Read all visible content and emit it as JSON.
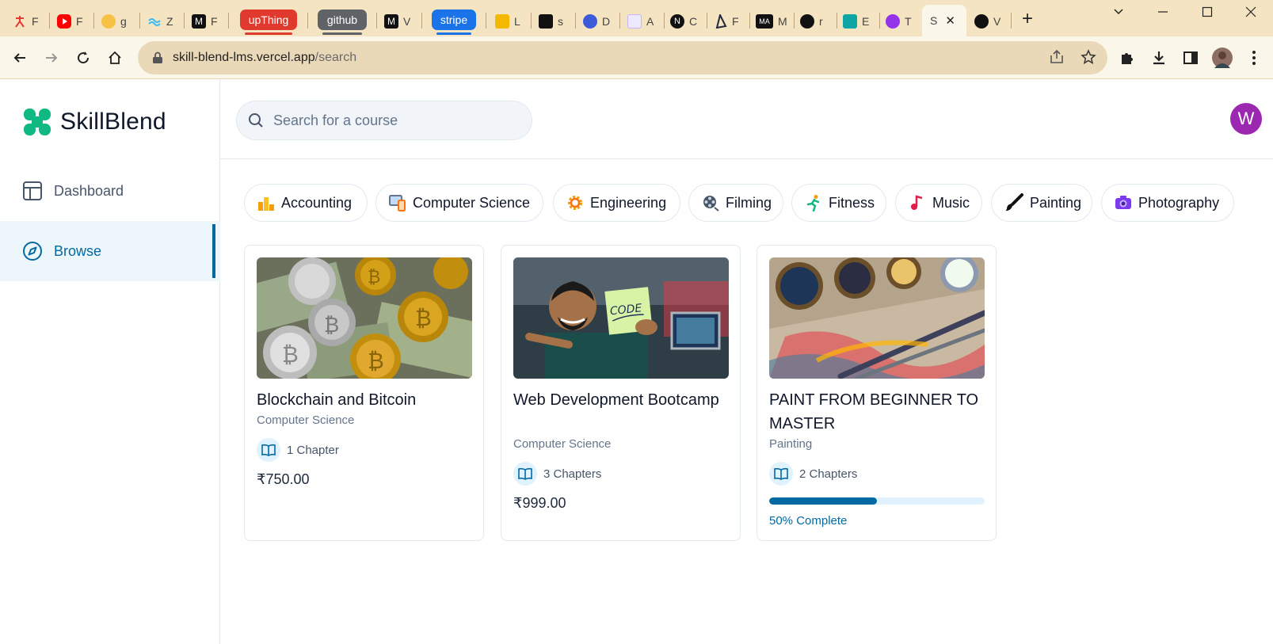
{
  "browser": {
    "tabs": [
      {
        "letter": "F",
        "icon": "figure-icon",
        "color": "#e53935"
      },
      {
        "letter": "F",
        "icon": "youtube-icon",
        "color": "#ff0000"
      },
      {
        "letter": "g",
        "icon": "emoji-icon",
        "color": "#f7c244"
      },
      {
        "letter": "Z",
        "icon": "wave-icon",
        "color": "#38bdf8"
      },
      {
        "letter": "F",
        "icon": "m-logo-icon",
        "color": "#111111"
      }
    ],
    "group_pills": [
      {
        "label": "upThing",
        "color": "#e03a2f"
      },
      {
        "label": "github",
        "color": "#5f6368"
      },
      {
        "label": "stripe",
        "color": "#1a73e8"
      }
    ],
    "tabs_after": [
      {
        "letter": "V",
        "icon": "m-logo-icon",
        "color": "#111111"
      },
      {
        "letter": "L",
        "icon": "m-yellow-icon",
        "color": "#f5b800"
      },
      {
        "letter": "s",
        "icon": "slash-icon",
        "color": "#111111"
      },
      {
        "letter": "D",
        "icon": "c-logo-icon",
        "color": "#3b5bdb"
      },
      {
        "letter": "A",
        "icon": "stripe-s-icon",
        "color": "#7c3aed"
      },
      {
        "letter": "C",
        "icon": "next-icon",
        "color": "#111111"
      },
      {
        "letter": "F",
        "icon": "prisma-icon",
        "color": "#1e293b"
      },
      {
        "letter": "M",
        "icon": "ma-icon",
        "color": "#111111"
      },
      {
        "letter": "r",
        "icon": "github-icon",
        "color": "#111111"
      },
      {
        "letter": "E",
        "icon": "d-logo-icon",
        "color": "#0ea5a4"
      },
      {
        "letter": "T",
        "icon": "u-logo-icon",
        "color": "#9333ea"
      }
    ],
    "active_tab": {
      "letter": "S",
      "close": "✕"
    },
    "last_tab": {
      "letter": "V",
      "icon": "github-icon"
    },
    "new_tab": "+",
    "url_host": "skill-blend-lms.vercel.app",
    "url_path": "/search"
  },
  "app": {
    "logo_text": "SkillBlend",
    "nav": [
      {
        "label": "Dashboard",
        "icon": "layout-icon",
        "active": false
      },
      {
        "label": "Browse",
        "icon": "compass-icon",
        "active": true
      }
    ],
    "search": {
      "placeholder": "Search for a course",
      "value": ""
    },
    "avatar_letter": "W",
    "categories": [
      {
        "label": "Accounting",
        "icon": "bar-chart-emoji-icon"
      },
      {
        "label": "Computer Science",
        "icon": "devices-emoji-icon"
      },
      {
        "label": "Engineering",
        "icon": "gear-emoji-icon"
      },
      {
        "label": "Filming",
        "icon": "film-reel-emoji-icon"
      },
      {
        "label": "Fitness",
        "icon": "runner-emoji-icon"
      },
      {
        "label": "Music",
        "icon": "music-note-emoji-icon"
      },
      {
        "label": "Painting",
        "icon": "paintbrush-emoji-icon"
      },
      {
        "label": "Photography",
        "icon": "camera-emoji-icon"
      }
    ],
    "courses": [
      {
        "title": "Blockchain and Bitcoin",
        "category": "Computer Science",
        "chapters": "1 Chapter",
        "price": "₹750.00",
        "progress_label": null,
        "progress": null
      },
      {
        "title": "Web Development Bootcamp",
        "category": "Computer Science",
        "chapters": "3 Chapters",
        "price": "₹999.00",
        "progress_label": null,
        "progress": null
      },
      {
        "title": "PAINT FROM BEGINNER TO MASTER",
        "category": "Painting",
        "chapters": "2 Chapters",
        "price": null,
        "progress_label": "50% Complete",
        "progress": 0.5
      }
    ]
  }
}
